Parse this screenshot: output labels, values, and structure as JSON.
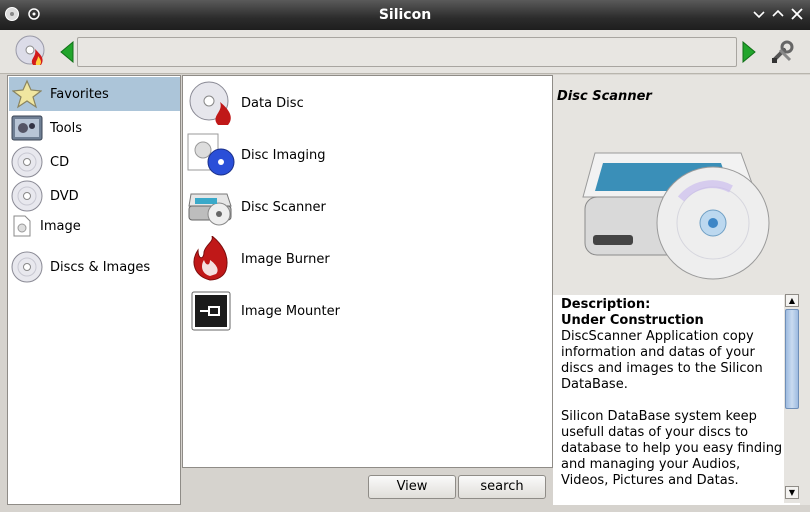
{
  "window": {
    "title": "Silicon"
  },
  "sidebar": {
    "items": [
      {
        "label": "Favorites",
        "icon": "star-icon",
        "selected": true
      },
      {
        "label": "Tools",
        "icon": "tools-icon",
        "selected": false
      },
      {
        "label": "CD",
        "icon": "cd-icon",
        "selected": false
      },
      {
        "label": "DVD",
        "icon": "dvd-icon",
        "selected": false
      },
      {
        "label": "Image",
        "icon": "image-file-icon",
        "selected": false
      },
      {
        "label": "Discs & Images",
        "icon": "discs-icon",
        "selected": false
      }
    ]
  },
  "apps": {
    "items": [
      {
        "label": "Data Disc",
        "icon": "data-disc-icon"
      },
      {
        "label": "Disc Imaging",
        "icon": "disc-imaging-icon"
      },
      {
        "label": "Disc Scanner",
        "icon": "disc-scanner-icon"
      },
      {
        "label": "Image Burner",
        "icon": "image-burner-icon"
      },
      {
        "label": "Image Mounter",
        "icon": "image-mounter-icon"
      }
    ]
  },
  "buttons": {
    "view": "View",
    "search": "search"
  },
  "details": {
    "title": "Disc Scanner",
    "desc_heading": "Description:",
    "desc_status": "Under Construction",
    "desc_para1": "DiscScanner Application copy information and datas of your discs and images to the Silicon DataBase.",
    "desc_para2": "Silicon DataBase system keep usefull datas of your discs to database to help you easy finding and managing your Audios, Videos, Pictures and Datas."
  },
  "colors": {
    "accent_selected": "#acc5d9",
    "nav_arrow": "#22a52c",
    "titlebar": "#2c2c2c"
  }
}
